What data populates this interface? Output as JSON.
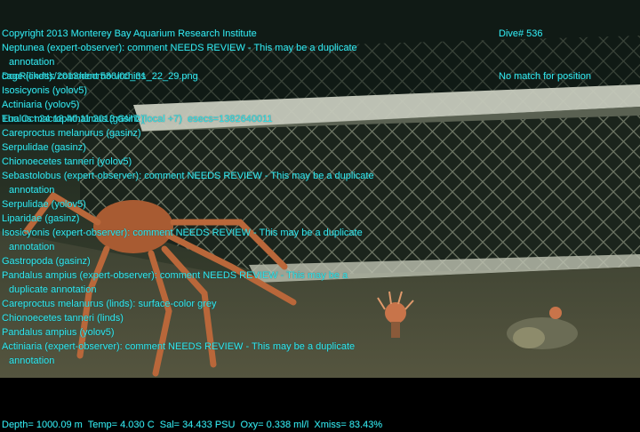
{
  "header_left": [
    "Copyright 2013 Monterey Bay Aquarium Research Institute",
    "DocRicketts/2013/docr536/00_31_22_29.png",
    "Thu Oct 24 18:40:11 2013 GMT (local +7)  esecs=1382640011"
  ],
  "header_right": [
    "Dive# 536",
    "No match for position"
  ],
  "annotations": [
    {
      "text": "Neptunea (expert-observer): comment NEEDS REVIEW - This may be a duplicate",
      "cont": "annotation"
    },
    {
      "text": "cage (linds): comment no urchins"
    },
    {
      "text": "Isosicyonis (yolov5)"
    },
    {
      "text": "Actiniaria (yolov5)"
    },
    {
      "text": "Eualus macrophthalmus (gasinz)"
    },
    {
      "text": "Careproctus melanurus (gasinz)"
    },
    {
      "text": "Serpulidae (gasinz)"
    },
    {
      "text": "Chionoecetes tanneri (yolov5)"
    },
    {
      "text": "Sebastolobus (expert-observer): comment NEEDS REVIEW - This may be a duplicate",
      "cont": "annotation"
    },
    {
      "text": "Serpulidae (yolov5)"
    },
    {
      "text": "Liparidae (gasinz)"
    },
    {
      "text": "Isosicyonis (expert-observer): comment NEEDS REVIEW - This may be a duplicate",
      "cont": "annotation"
    },
    {
      "text": "Gastropoda (gasinz)"
    },
    {
      "text": "Pandalus ampius (expert-observer): comment NEEDS REVIEW - This may be a",
      "cont": "duplicate annotation"
    },
    {
      "text": "Careproctus melanurus (linds): surface-color grey"
    },
    {
      "text": "Chionoecetes tanneri (linds)"
    },
    {
      "text": "Pandalus ampius (yolov5)"
    },
    {
      "text": "Actiniaria (expert-observer): comment NEEDS REVIEW - This may be a duplicate",
      "cont": "annotation"
    }
  ],
  "footer": "Depth= 1000.09 m  Temp= 4.030 C  Sal= 34.433 PSU  Oxy= 0.338 ml/l  Xmiss= 83.43%"
}
